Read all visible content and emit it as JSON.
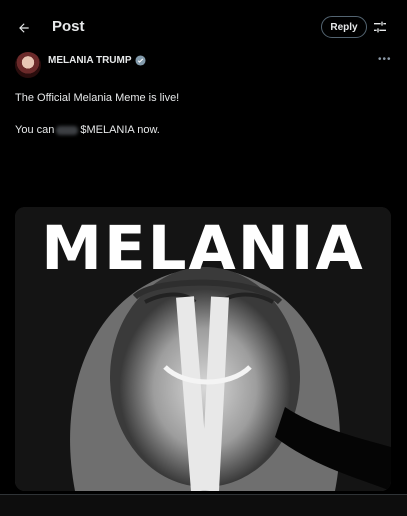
{
  "header": {
    "title": "Post",
    "reply_label": "Reply",
    "back_icon": "arrow-left-icon",
    "filter_icon": "sliders-icon"
  },
  "post": {
    "author": "MELANIA TRUMP",
    "verified": true,
    "line1": "The Official Melania Meme is live!",
    "line2_before": "You can",
    "line2_after": "$MELANIA now.",
    "media_title": "MELANIA"
  },
  "colors": {
    "background": "#000000",
    "text": "#e7e9ea",
    "verified": "#829aab"
  }
}
